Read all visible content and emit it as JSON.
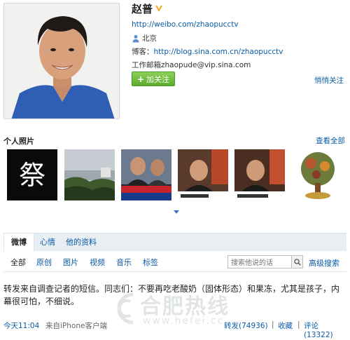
{
  "profile": {
    "name": "赵普",
    "homepage_url": "http://weibo.com/zhaopucctv",
    "location": "北京",
    "blog_label": "博客：",
    "blog_url": "http://blog.sina.com.cn/zhaopucctv",
    "email_label": "工作邮箱",
    "email": "zhaopude@vip.sina.com",
    "follow_button": "加关注",
    "quiet_follow": "悄悄关注",
    "verified_badge_color": "#f5a623"
  },
  "photos": {
    "title": "个人照片",
    "view_all": "查看全部",
    "thumbs": [
      {
        "name": "thumb-ji-character",
        "glyph": "祭"
      },
      {
        "name": "thumb-landscape"
      },
      {
        "name": "thumb-news-broadcast-1"
      },
      {
        "name": "thumb-news-broadcast-2"
      },
      {
        "name": "thumb-news-broadcast-3"
      },
      {
        "name": "thumb-tree-illustration"
      }
    ]
  },
  "tabs": [
    {
      "label": "微博",
      "active": true
    },
    {
      "label": "心情",
      "active": false
    },
    {
      "label": "他的资料",
      "active": false
    }
  ],
  "filters": [
    {
      "label": "全部",
      "active": true
    },
    {
      "label": "原创",
      "active": false
    },
    {
      "label": "图片",
      "active": false
    },
    {
      "label": "视频",
      "active": false
    },
    {
      "label": "音乐",
      "active": false
    },
    {
      "label": "标签",
      "active": false
    }
  ],
  "search": {
    "placeholder": "搜索他说的话",
    "advanced": "高级搜索"
  },
  "post": {
    "text": "转发来自调查记者的短信。同志们：不要再吃老酸奶（固体形态）和果冻，尤其是孩子，内幕很可怕，不细说。",
    "time": "今天11:04",
    "source": "来自iPhone客户端",
    "forward": "转发(74936)",
    "favorite": "收藏",
    "comment": "评论(13322)",
    "separator": "|"
  },
  "watermark": {
    "text": "合肥热线",
    "url": "www.hefei.cc"
  },
  "colors": {
    "link": "#0a5ba8",
    "follow_green": "#5aab2e",
    "tab_bar": "#e9eef3"
  }
}
